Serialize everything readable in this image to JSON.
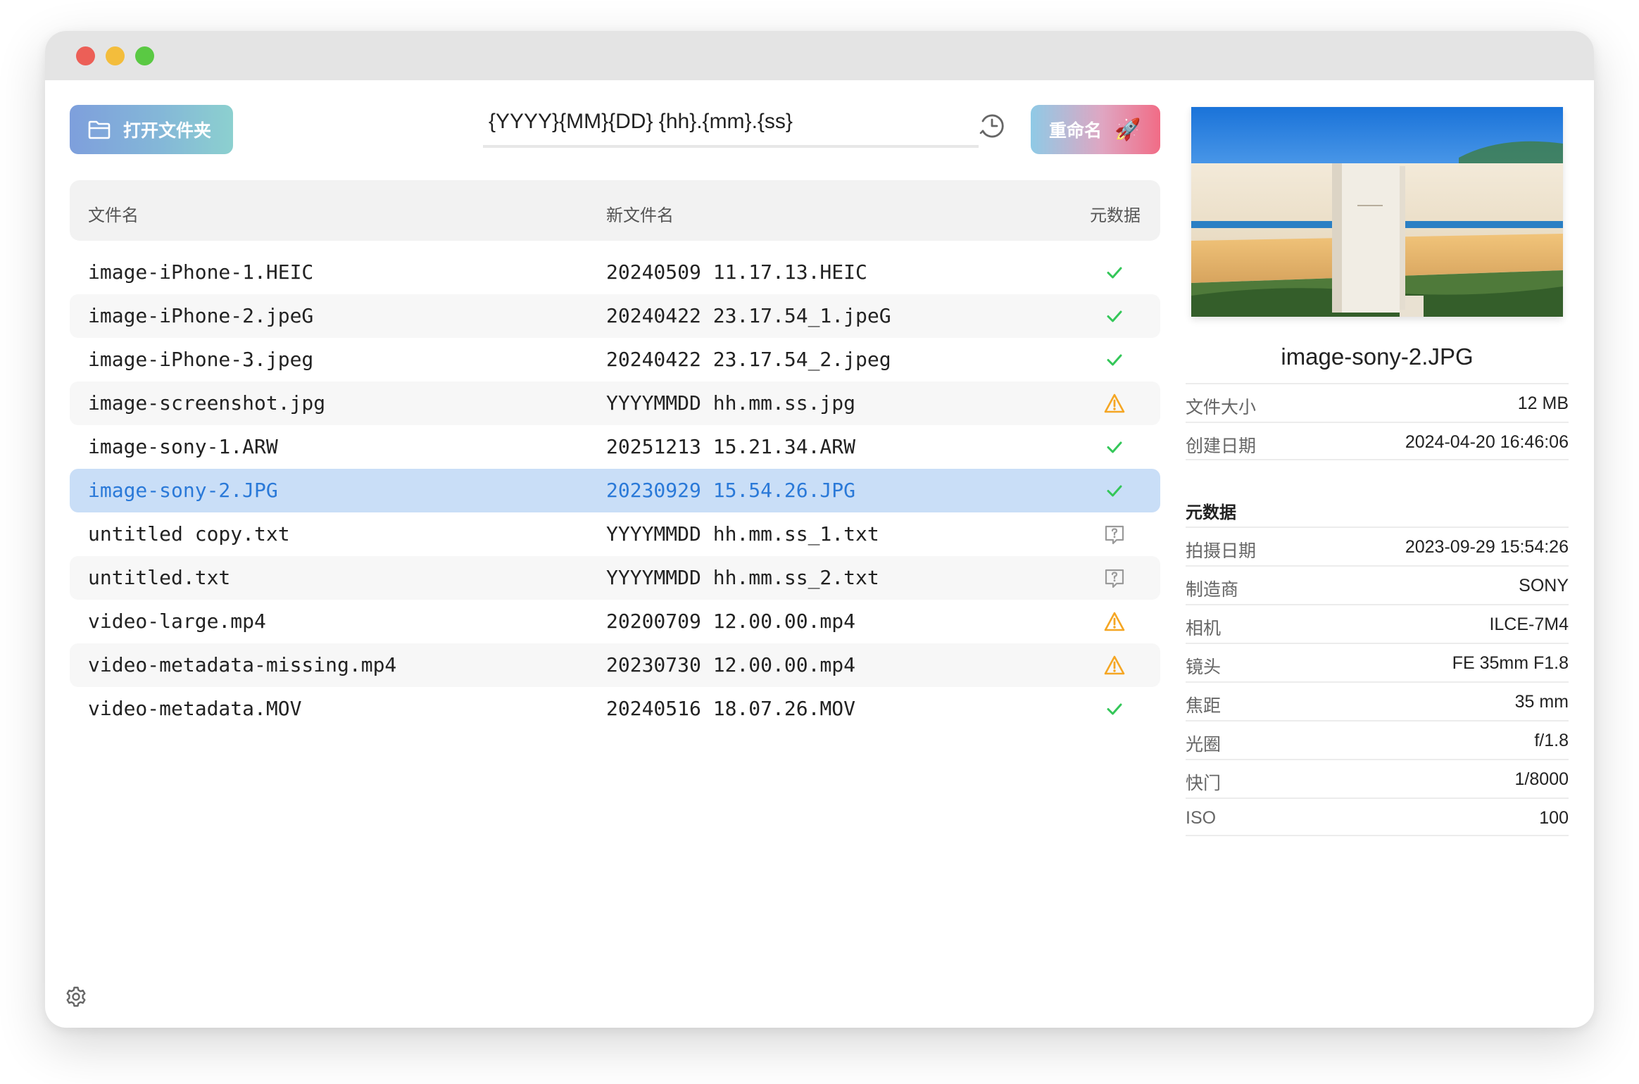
{
  "toolbar": {
    "open_folder_label": "打开文件夹",
    "pattern_value": "{YYYY}{MM}{DD} {hh}.{mm}.{ss}",
    "rename_label": "重命名"
  },
  "table": {
    "headers": {
      "name": "文件名",
      "new_name": "新文件名",
      "metadata": "元数据"
    },
    "rows": [
      {
        "name": "image-iPhone-1.HEIC",
        "new_name": "20240509 11.17.13.HEIC",
        "status": "ok"
      },
      {
        "name": "image-iPhone-2.jpeG",
        "new_name": "20240422 23.17.54_1.jpeG",
        "status": "ok"
      },
      {
        "name": "image-iPhone-3.jpeg",
        "new_name": "20240422 23.17.54_2.jpeg",
        "status": "ok"
      },
      {
        "name": "image-screenshot.jpg",
        "new_name": "YYYYMMDD hh.mm.ss.jpg",
        "status": "warning"
      },
      {
        "name": "image-sony-1.ARW",
        "new_name": "20251213 15.21.34.ARW",
        "status": "ok"
      },
      {
        "name": "image-sony-2.JPG",
        "new_name": "20230929 15.54.26.JPG",
        "status": "ok"
      },
      {
        "name": "untitled copy.txt",
        "new_name": "YYYYMMDD hh.mm.ss_1.txt",
        "status": "unknown"
      },
      {
        "name": "untitled.txt",
        "new_name": "YYYYMMDD hh.mm.ss_2.txt",
        "status": "unknown"
      },
      {
        "name": "video-large.mp4",
        "new_name": "20200709 12.00.00.mp4",
        "status": "warning"
      },
      {
        "name": "video-metadata-missing.mp4",
        "new_name": "20230730 12.00.00.mp4",
        "status": "warning"
      },
      {
        "name": "video-metadata.MOV",
        "new_name": "20240516 18.07.26.MOV",
        "status": "ok"
      }
    ],
    "selected_index": 5
  },
  "details": {
    "file_name": "image-sony-2.JPG",
    "file_info": [
      {
        "label": "文件大小",
        "value": "12 MB"
      },
      {
        "label": "创建日期",
        "value": "2024-04-20 16:46:06"
      }
    ],
    "metadata_title": "元数据",
    "metadata": [
      {
        "label": "拍摄日期",
        "value": "2023-09-29 15:54:26"
      },
      {
        "label": "制造商",
        "value": "SONY"
      },
      {
        "label": "相机",
        "value": "ILCE-7M4"
      },
      {
        "label": "镜头",
        "value": "FE 35mm F1.8"
      },
      {
        "label": "焦距",
        "value": "35 mm"
      },
      {
        "label": "光圈",
        "value": "f/1.8"
      },
      {
        "label": "快门",
        "value": "1/8000"
      },
      {
        "label": "ISO",
        "value": "100"
      }
    ]
  },
  "colors": {
    "ok": "#34c759",
    "warning": "#f5a623",
    "unknown": "#9a9a9a",
    "selected_row": "#c9def7",
    "selected_text": "#2a79d8"
  },
  "icons": {
    "open_folder": "folder-icon",
    "history": "history-clock-icon",
    "rename": "rocket-icon",
    "settings": "gear-icon"
  }
}
